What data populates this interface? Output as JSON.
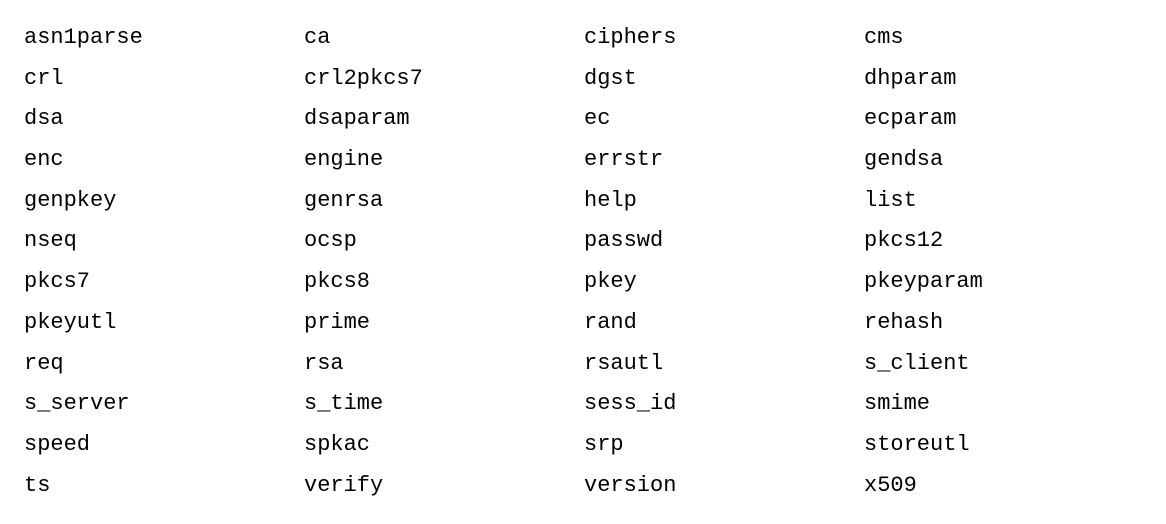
{
  "commands": {
    "rows": [
      [
        "asn1parse",
        "ca",
        "ciphers",
        "cms"
      ],
      [
        "crl",
        "crl2pkcs7",
        "dgst",
        "dhparam"
      ],
      [
        "dsa",
        "dsaparam",
        "ec",
        "ecparam"
      ],
      [
        "enc",
        "engine",
        "errstr",
        "gendsa"
      ],
      [
        "genpkey",
        "genrsa",
        "help",
        "list"
      ],
      [
        "nseq",
        "ocsp",
        "passwd",
        "pkcs12"
      ],
      [
        "pkcs7",
        "pkcs8",
        "pkey",
        "pkeyparam"
      ],
      [
        "pkeyutl",
        "prime",
        "rand",
        "rehash"
      ],
      [
        "req",
        "rsa",
        "rsautl",
        "s_client"
      ],
      [
        "s_server",
        "s_time",
        "sess_id",
        "smime"
      ],
      [
        "speed",
        "spkac",
        "srp",
        "storeutl"
      ],
      [
        "ts",
        "verify",
        "version",
        "x509"
      ]
    ]
  }
}
